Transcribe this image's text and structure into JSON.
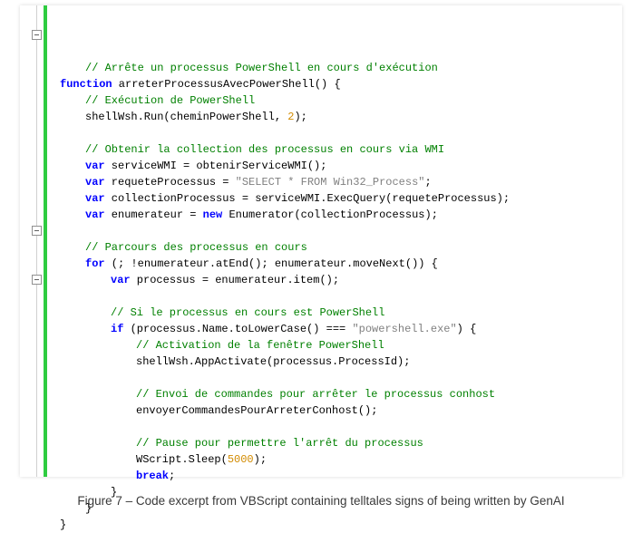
{
  "caption": "Figure 7 – Code excerpt from VBScript containing telltales signs of being written by GenAI",
  "syntax_colors": {
    "comment": "#008000",
    "keyword": "#0000ff",
    "string": "#808080",
    "number": "#d28b00",
    "default": "#000000",
    "change_bar": "#2ecc40"
  },
  "fold_markers": {
    "icon": "minus-box",
    "line_indices": [
      1,
      13,
      16
    ]
  },
  "code_lines": [
    {
      "indent": 1,
      "tokens": [
        {
          "t": "// Arrête un processus PowerShell en cours d'exécution",
          "c": "comment"
        }
      ]
    },
    {
      "indent": 0,
      "tokens": [
        {
          "t": "function",
          "c": "keyword"
        },
        {
          "t": " arreterProcessusAvecPowerShell() {",
          "c": "default"
        }
      ]
    },
    {
      "indent": 1,
      "tokens": [
        {
          "t": "// Exécution de PowerShell",
          "c": "comment"
        }
      ]
    },
    {
      "indent": 1,
      "tokens": [
        {
          "t": "shellWsh.Run(cheminPowerShell, ",
          "c": "default"
        },
        {
          "t": "2",
          "c": "number"
        },
        {
          "t": ");",
          "c": "default"
        }
      ]
    },
    {
      "indent": 0,
      "tokens": [
        {
          "t": "",
          "c": "default"
        }
      ]
    },
    {
      "indent": 1,
      "tokens": [
        {
          "t": "// Obtenir la collection des processus en cours via WMI",
          "c": "comment"
        }
      ]
    },
    {
      "indent": 1,
      "tokens": [
        {
          "t": "var",
          "c": "keyword"
        },
        {
          "t": " serviceWMI = obtenirServiceWMI();",
          "c": "default"
        }
      ]
    },
    {
      "indent": 1,
      "tokens": [
        {
          "t": "var",
          "c": "keyword"
        },
        {
          "t": " requeteProcessus = ",
          "c": "default"
        },
        {
          "t": "\"SELECT * FROM Win32_Process\"",
          "c": "string"
        },
        {
          "t": ";",
          "c": "default"
        }
      ]
    },
    {
      "indent": 1,
      "tokens": [
        {
          "t": "var",
          "c": "keyword"
        },
        {
          "t": " collectionProcessus = serviceWMI.ExecQuery(requeteProcessus);",
          "c": "default"
        }
      ]
    },
    {
      "indent": 1,
      "tokens": [
        {
          "t": "var",
          "c": "keyword"
        },
        {
          "t": " enumerateur = ",
          "c": "default"
        },
        {
          "t": "new",
          "c": "keyword"
        },
        {
          "t": " Enumerator(collectionProcessus);",
          "c": "default"
        }
      ]
    },
    {
      "indent": 0,
      "tokens": [
        {
          "t": "",
          "c": "default"
        }
      ]
    },
    {
      "indent": 1,
      "tokens": [
        {
          "t": "// Parcours des processus en cours",
          "c": "comment"
        }
      ]
    },
    {
      "indent": 1,
      "tokens": [
        {
          "t": "for",
          "c": "keyword"
        },
        {
          "t": " (; !enumerateur.atEnd(); enumerateur.moveNext()) {",
          "c": "default"
        }
      ]
    },
    {
      "indent": 2,
      "tokens": [
        {
          "t": "var",
          "c": "keyword"
        },
        {
          "t": " processus = enumerateur.item();",
          "c": "default"
        }
      ]
    },
    {
      "indent": 0,
      "tokens": [
        {
          "t": "",
          "c": "default"
        }
      ]
    },
    {
      "indent": 2,
      "tokens": [
        {
          "t": "// Si le processus en cours est PowerShell",
          "c": "comment"
        }
      ]
    },
    {
      "indent": 2,
      "tokens": [
        {
          "t": "if",
          "c": "keyword"
        },
        {
          "t": " (processus.Name.toLowerCase() === ",
          "c": "default"
        },
        {
          "t": "\"powershell.exe\"",
          "c": "string"
        },
        {
          "t": ") {",
          "c": "default"
        }
      ]
    },
    {
      "indent": 3,
      "tokens": [
        {
          "t": "// Activation de la fenêtre PowerShell",
          "c": "comment"
        }
      ]
    },
    {
      "indent": 3,
      "tokens": [
        {
          "t": "shellWsh.AppActivate(processus.ProcessId);",
          "c": "default"
        }
      ]
    },
    {
      "indent": 0,
      "tokens": [
        {
          "t": "",
          "c": "default"
        }
      ]
    },
    {
      "indent": 3,
      "tokens": [
        {
          "t": "// Envoi de commandes pour arrêter le processus conhost",
          "c": "comment"
        }
      ]
    },
    {
      "indent": 3,
      "tokens": [
        {
          "t": "envoyerCommandesPourArreterConhost();",
          "c": "default"
        }
      ]
    },
    {
      "indent": 0,
      "tokens": [
        {
          "t": "",
          "c": "default"
        }
      ]
    },
    {
      "indent": 3,
      "tokens": [
        {
          "t": "// Pause pour permettre l'arrêt du processus",
          "c": "comment"
        }
      ]
    },
    {
      "indent": 3,
      "tokens": [
        {
          "t": "WScript.Sleep(",
          "c": "default"
        },
        {
          "t": "5000",
          "c": "number"
        },
        {
          "t": ");",
          "c": "default"
        }
      ]
    },
    {
      "indent": 3,
      "tokens": [
        {
          "t": "break",
          "c": "keyword"
        },
        {
          "t": ";",
          "c": "default"
        }
      ]
    },
    {
      "indent": 2,
      "tokens": [
        {
          "t": "}",
          "c": "default"
        }
      ]
    },
    {
      "indent": 1,
      "tokens": [
        {
          "t": "}",
          "c": "default"
        }
      ]
    },
    {
      "indent": 0,
      "tokens": [
        {
          "t": "}",
          "c": "default"
        }
      ]
    }
  ]
}
